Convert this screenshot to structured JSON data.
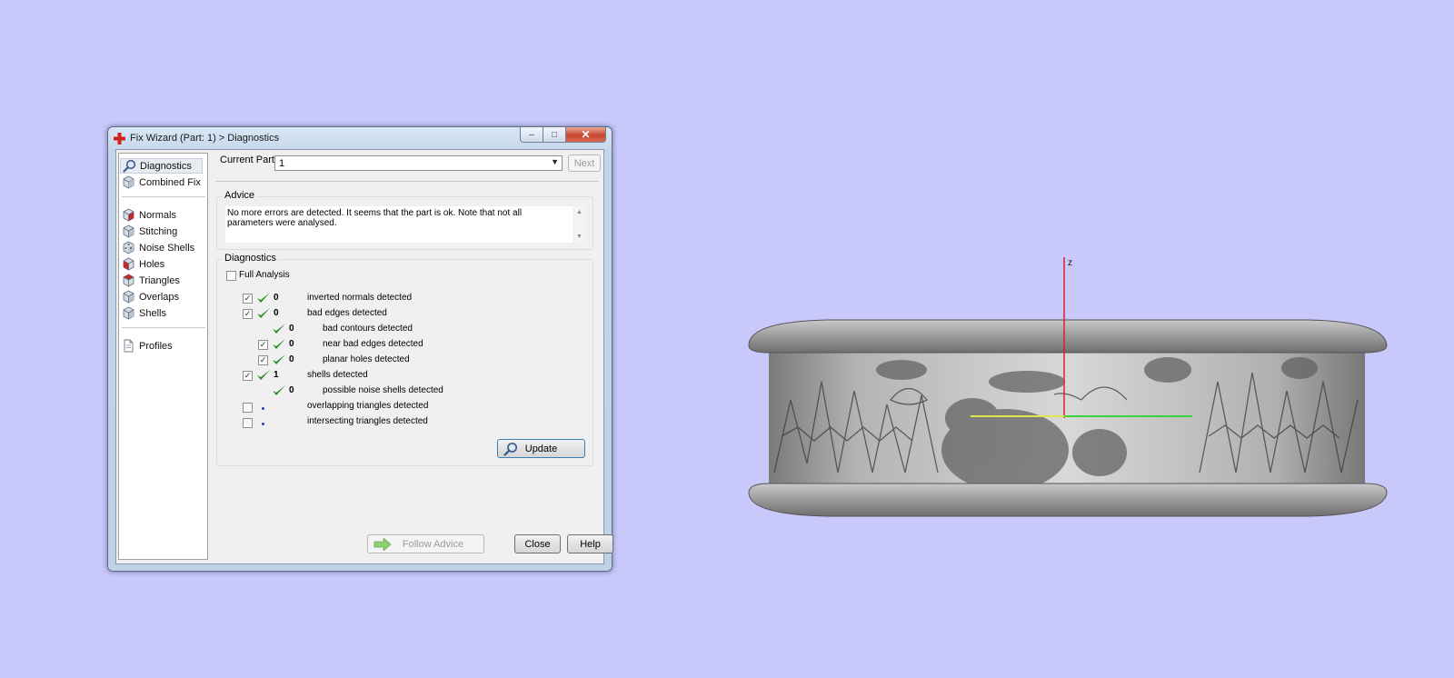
{
  "window": {
    "title": "Fix Wizard (Part: 1) > Diagnostics",
    "caption_min": "–",
    "caption_max": "□",
    "caption_close": "✕"
  },
  "nav": {
    "items": [
      {
        "label": "Diagnostics",
        "icon": "magnifier-icon"
      },
      {
        "label": "Combined Fix",
        "icon": "cube-icon"
      },
      {
        "label": "Normals",
        "icon": "cube-red-face-icon"
      },
      {
        "label": "Stitching",
        "icon": "cube-icon"
      },
      {
        "label": "Noise Shells",
        "icon": "cube-dots-icon"
      },
      {
        "label": "Holes",
        "icon": "cube-red-face-icon"
      },
      {
        "label": "Triangles",
        "icon": "cube-red-face-icon"
      },
      {
        "label": "Overlaps",
        "icon": "cube-icon"
      },
      {
        "label": "Shells",
        "icon": "cube-icon"
      },
      {
        "label": "Profiles",
        "icon": "document-icon"
      }
    ]
  },
  "header": {
    "current_part_label": "Current Part:",
    "current_part_value": "1",
    "next_label": "Next"
  },
  "advice": {
    "title": "Advice",
    "text": "No more errors are detected. It seems that the part is ok. Note that not all parameters were analysed."
  },
  "diagnostics": {
    "title": "Diagnostics",
    "full_analysis_label": "Full Analysis",
    "full_analysis_checked": false,
    "rows": [
      {
        "label": "inverted normals detected",
        "count": "0",
        "checked": true,
        "status": "ok"
      },
      {
        "label": "bad edges detected",
        "count": "0",
        "checked": true,
        "status": "ok"
      },
      {
        "label": "bad contours detected",
        "count": "0",
        "checked": null,
        "status": "ok"
      },
      {
        "label": "near bad edges detected",
        "count": "0",
        "checked": true,
        "status": "ok"
      },
      {
        "label": "planar holes detected",
        "count": "0",
        "checked": true,
        "status": "ok"
      },
      {
        "label": "shells detected",
        "count": "1",
        "checked": true,
        "status": "ok"
      },
      {
        "label": "possible noise shells detected",
        "count": "0",
        "checked": null,
        "status": "ok"
      },
      {
        "label": "overlapping triangles detected",
        "count": "",
        "checked": false,
        "status": "not-analysed"
      },
      {
        "label": "intersecting triangles detected",
        "count": "",
        "checked": false,
        "status": "not-analysed"
      }
    ],
    "update_label": "Update"
  },
  "footer": {
    "follow_advice_label": "Follow Advice",
    "close_label": "Close",
    "help_label": "Help"
  },
  "viewport": {
    "axis_label": "z",
    "axis_colors": {
      "z": "#e0201e",
      "x": "#e7e24a",
      "y": "#3cd23c"
    },
    "model_description_color": "#8e8e8e"
  },
  "colors": {
    "background": "#c8c8fa",
    "check_green": "#2a8a22",
    "dot_blue": "#2d3fb8"
  }
}
